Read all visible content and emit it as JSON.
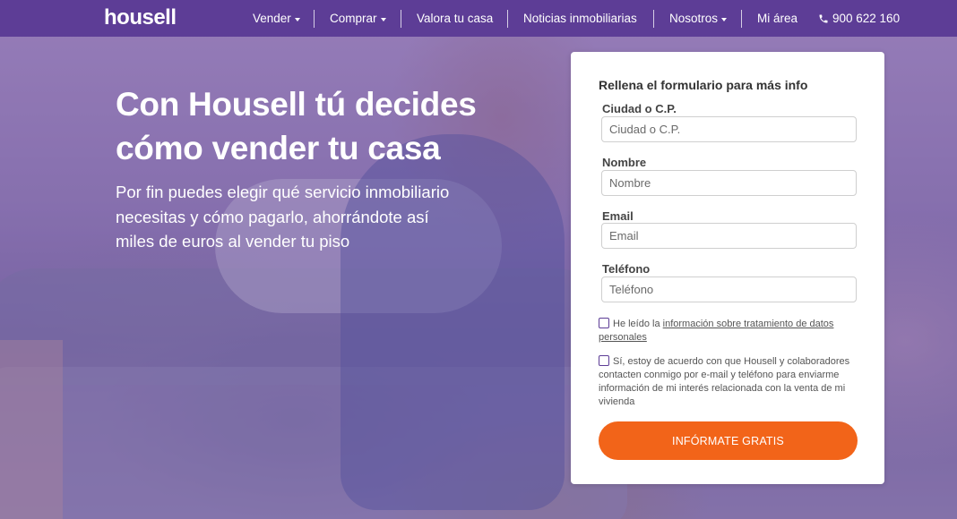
{
  "brand": {
    "logo_text": "housell"
  },
  "nav": {
    "items": [
      {
        "label": "Vender",
        "has_caret": true
      },
      {
        "label": "Comprar",
        "has_caret": true
      },
      {
        "label": "Valora tu casa",
        "has_caret": false
      },
      {
        "label": "Noticias inmobiliarias",
        "has_caret": false
      },
      {
        "label": "Nosotros",
        "has_caret": true
      },
      {
        "label": "Mi área",
        "has_caret": false
      }
    ],
    "phone": {
      "icon": "phone-icon",
      "number": "900 622 160"
    }
  },
  "hero": {
    "title_line1": "Con Housell tú decides",
    "title_line2": "cómo vender tu casa",
    "subtitle_line1": "Por fin puedes elegir qué servicio inmobiliario",
    "subtitle_line2": "necesitas y cómo pagarlo, ahorrándote así",
    "subtitle_line3": "miles de euros al vender tu piso"
  },
  "form": {
    "heading": "Rellena el formulario para más info",
    "fields": [
      {
        "label": "Ciudad o C.P.",
        "placeholder": "Ciudad o C.P.",
        "value": ""
      },
      {
        "label": "Nombre",
        "placeholder": "Nombre",
        "value": ""
      },
      {
        "label": "Email",
        "placeholder": "Email",
        "value": ""
      },
      {
        "label": "Teléfono",
        "placeholder": "Teléfono",
        "value": ""
      }
    ],
    "privacy_check": {
      "prefix": "He leído la ",
      "link_text": "información sobre tratamiento de datos personales",
      "checked": false
    },
    "contact_check": {
      "text": "Sí, estoy de acuerdo con que Housell y colaboradores contacten conmigo por e-mail y teléfono para enviarme información de mi interés relacionada con la venta de mi vivienda",
      "checked": false
    },
    "submit_label": "INFÓRMATE GRATIS"
  },
  "colors": {
    "nav_bg": "#5d3d96",
    "accent_orange": "#f26419",
    "checkbox_border": "#5d3d96"
  }
}
